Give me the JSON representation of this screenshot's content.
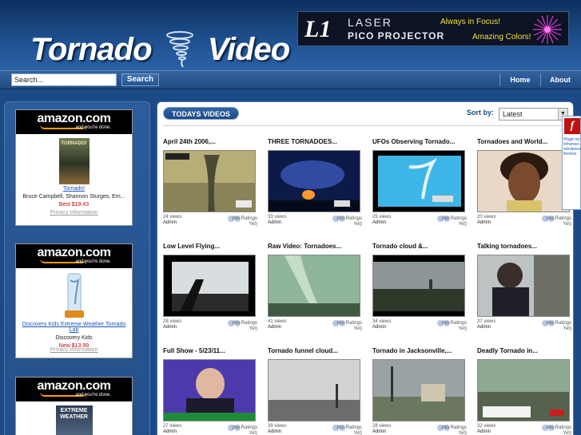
{
  "header": {
    "logo_word1": "Tornado",
    "logo_word2": "Video",
    "banner": {
      "mark": "L1",
      "line1": "LASER",
      "line2": "PICO PROJECTOR",
      "tag1": "Always in Focus!",
      "tag2": "Amazing Colors!"
    }
  },
  "nav": {
    "search_value": "Search...",
    "search_button": "Search",
    "links": [
      "Home",
      "About"
    ]
  },
  "sidebar": {
    "ads": [
      {
        "brand": "amazon.com",
        "tagline": "and you're done.",
        "product": "Tornado!",
        "subtitle": "Bruce Campbell, Shannon Sturges, Em...",
        "price_label": "Best",
        "price": "$19.43",
        "privacy": "Privacy Information",
        "cover_text": "TORNADO!"
      },
      {
        "brand": "amazon.com",
        "tagline": "and you're done.",
        "product": "Discovery Kids Extreme Weather Tornado Lab",
        "subtitle": "Discovery Kids",
        "price_label": "New",
        "price": "$13.99",
        "privacy": "Privacy Information",
        "cover_text": ""
      },
      {
        "brand": "amazon.com",
        "tagline": "and you're done.",
        "product": "",
        "subtitle": "",
        "price_label": "",
        "price": "",
        "privacy": "",
        "cover_text": "EXTREME WEATHER"
      }
    ]
  },
  "main": {
    "section_title": "TODAYS VIDEOS",
    "sort_label": "Sort by:",
    "sort_value": "Latest",
    "videos": [
      {
        "title": "April 24th 2006,...",
        "views": "24 views",
        "author": "Admin",
        "rating": "(No Ratings Yet)"
      },
      {
        "title": "THREE TORNADOES...",
        "views": "33 views",
        "author": "Admin",
        "rating": "(No Ratings Yet)"
      },
      {
        "title": "UFOs Observing Tornado...",
        "views": "25 views",
        "author": "Admin",
        "rating": "(No Ratings Yet)"
      },
      {
        "title": "Tornadoes and World...",
        "views": "20 views",
        "author": "Admin",
        "rating": "(No Ratings Yet)"
      },
      {
        "title": "Low Level Flying...",
        "views": "28 views",
        "author": "Admin",
        "rating": "(No Ratings Yet)"
      },
      {
        "title": "Raw Video: Tornadoes...",
        "views": "41 views",
        "author": "Admin",
        "rating": "(No Ratings Yet)"
      },
      {
        "title": "Tornado cloud &...",
        "views": "34 views",
        "author": "Admin",
        "rating": "(No Ratings Yet)"
      },
      {
        "title": "Talking tornadoes...",
        "views": "37 views",
        "author": "Admin",
        "rating": "(No Ratings Yet)"
      },
      {
        "title": "Full Show - 5/23/11...",
        "views": "27 views",
        "author": "Admin",
        "rating": "(No Ratings Yet)"
      },
      {
        "title": "Tornado funnel cloud...",
        "views": "39 views",
        "author": "Admin",
        "rating": "(No Ratings Yet)"
      },
      {
        "title": "Tornado in Jacksonville,...",
        "views": "28 views",
        "author": "Admin",
        "rating": "(No Ratings Yet)"
      },
      {
        "title": "Deadly Tornado in...",
        "views": "32 views",
        "author": "Admin",
        "rating": "(No Ratings Yet)"
      }
    ]
  },
  "plugin": {
    "text": "Plugin by Inframeo wordpress themes"
  }
}
